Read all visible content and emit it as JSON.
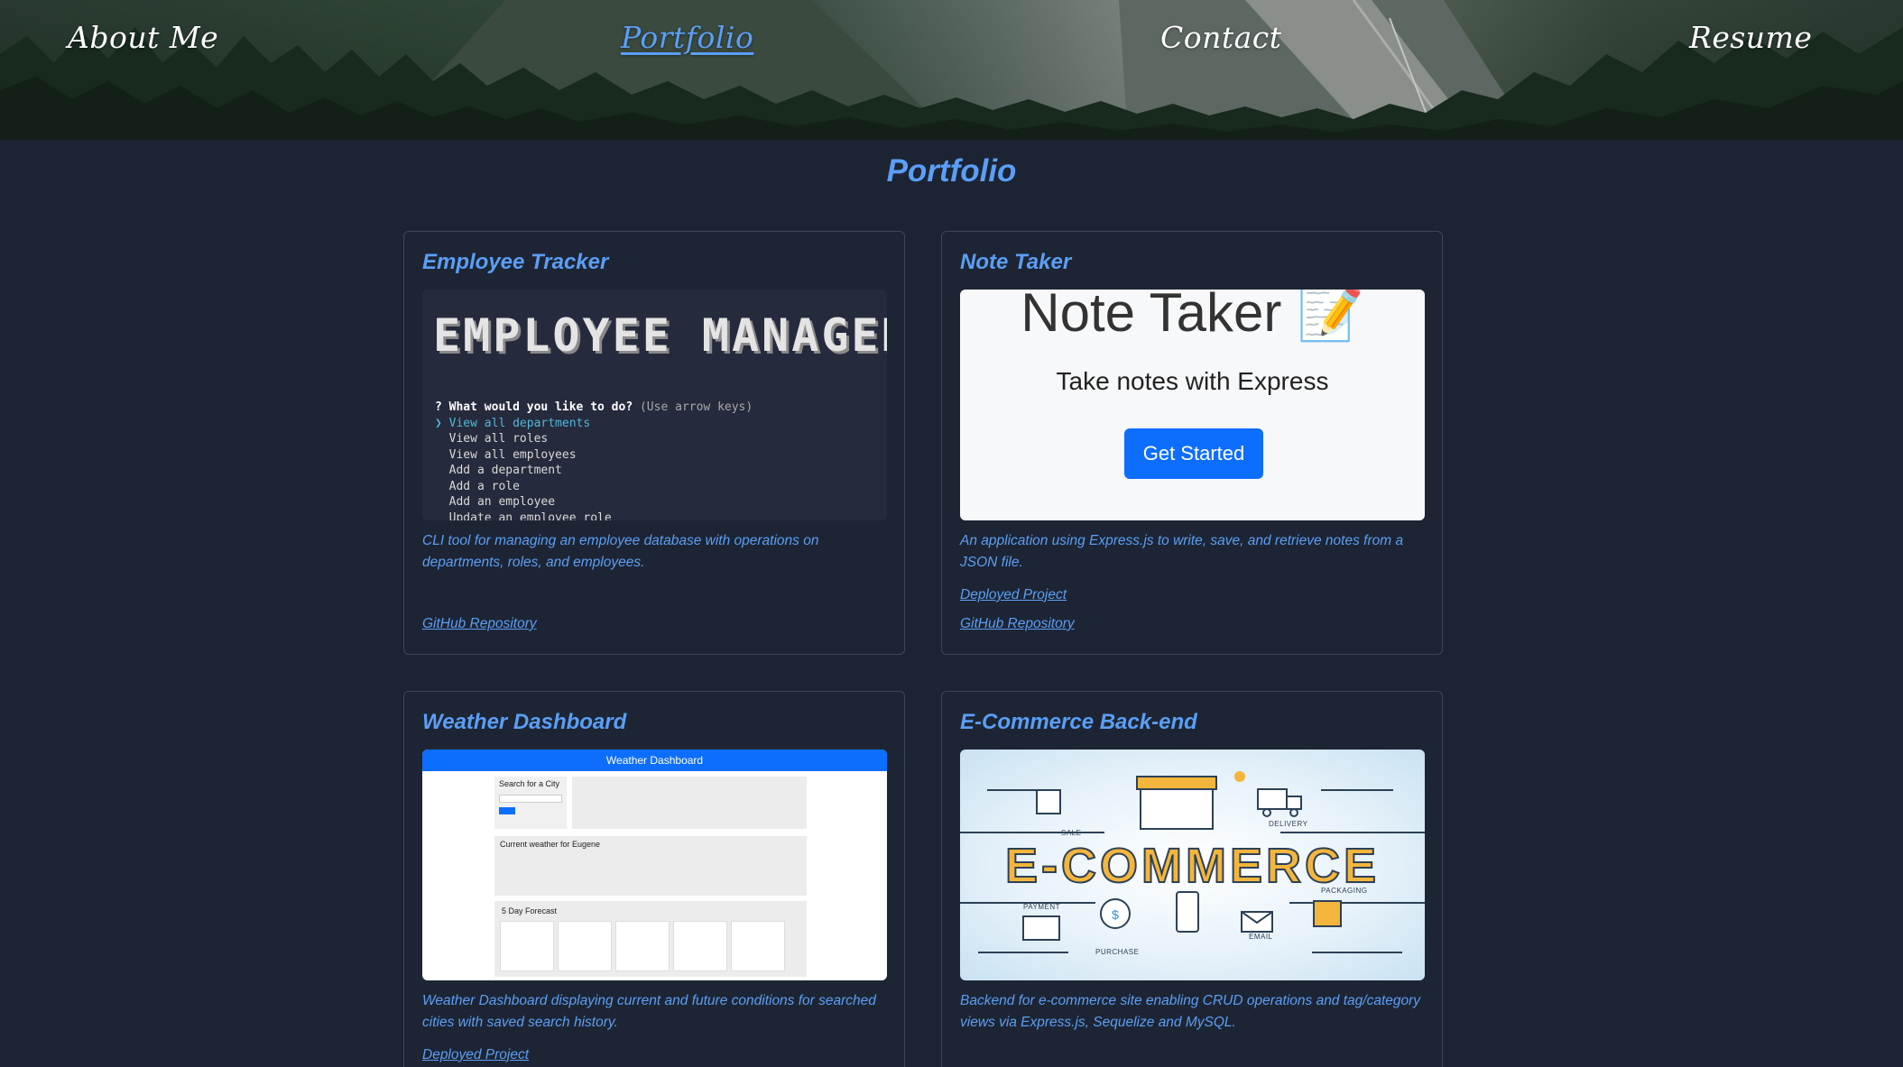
{
  "nav": {
    "items": [
      {
        "label": "About Me",
        "active": false
      },
      {
        "label": "Portfolio",
        "active": true
      },
      {
        "label": "Contact",
        "active": false
      },
      {
        "label": "Resume",
        "active": false
      }
    ]
  },
  "page": {
    "title": "Portfolio"
  },
  "colors": {
    "accent": "#5b9ef5",
    "background": "#1c2433",
    "card_border": "#3d4757",
    "nav_text": "#ffffff"
  },
  "projects": [
    {
      "title": "Employee Tracker",
      "description": "CLI tool for managing an employee database with operations on departments, roles, and employees.",
      "links": [
        "GitHub Repository"
      ],
      "image": {
        "banner": "EMPLOYEE MANAGER",
        "prompt": "What would you like to do?",
        "hint": "(Use arrow keys)",
        "options": [
          "View all departments",
          "View all roles",
          "View all employees",
          "Add a department",
          "Add a role",
          "Add an employee",
          "Update an employee role"
        ]
      }
    },
    {
      "title": "Note Taker",
      "description": "An application using Express.js to write, save, and retrieve notes from a JSON file.",
      "links": [
        "Deployed Project",
        "GitHub Repository"
      ],
      "image": {
        "heading": "Note Taker",
        "subheading": "Take notes with Express",
        "button": "Get Started"
      }
    },
    {
      "title": "Weather Dashboard",
      "description": "Weather Dashboard displaying current and future conditions for searched cities with saved search history.",
      "links": [
        "Deployed Project"
      ],
      "image": {
        "bar_title": "Weather Dashboard",
        "search_label": "Search for a City",
        "current": "Current weather for Eugene",
        "forecast": "5 Day Forecast"
      }
    },
    {
      "title": "E-Commerce Back-end",
      "description": "Backend for e-commerce site enabling CRUD operations and tag/category views via Express.js, Sequelize and MySQL.",
      "links": [],
      "image": {
        "word": "E-COMMERCE",
        "labels": [
          "SALE",
          "DELIVERY",
          "PAYMENT",
          "PACKAGING",
          "PURCHASE",
          "EMAIL"
        ]
      }
    }
  ]
}
